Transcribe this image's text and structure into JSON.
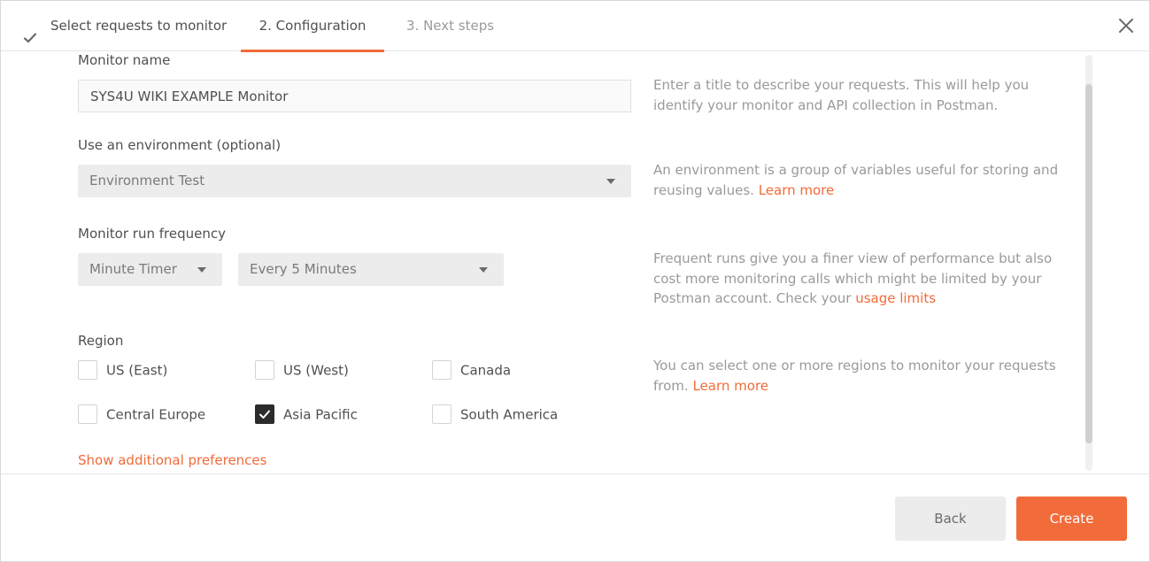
{
  "tabs": [
    {
      "label": "Select requests to monitor",
      "state": "completed"
    },
    {
      "label": "2. Configuration",
      "state": "active"
    },
    {
      "label": "3. Next steps",
      "state": "inactive"
    }
  ],
  "colors": {
    "accent": "#f26b3a",
    "muted": "#9a9a9a",
    "text": "#505050"
  },
  "form": {
    "monitor_name": {
      "label": "Monitor name",
      "value": "SYS4U WIKI EXAMPLE Monitor",
      "help": "Enter a title to describe your requests. This will help you identify your monitor and API collection in Postman."
    },
    "environment": {
      "label": "Use an environment (optional)",
      "selected": "Environment Test",
      "help": "An environment is a group of variables useful for storing and reusing values.",
      "help_link": "Learn more"
    },
    "frequency": {
      "label": "Monitor run frequency",
      "timer_selected": "Minute Timer",
      "interval_selected": "Every 5 Minutes",
      "help": "Frequent runs give you a finer view of performance but also cost more monitoring calls which might be limited by your Postman account. Check your",
      "help_link": "usage limits"
    },
    "region": {
      "label": "Region",
      "options": [
        {
          "label": "US (East)",
          "checked": false
        },
        {
          "label": "US (West)",
          "checked": false
        },
        {
          "label": "Canada",
          "checked": false
        },
        {
          "label": "Central Europe",
          "checked": false
        },
        {
          "label": "Asia Pacific",
          "checked": true
        },
        {
          "label": "South America",
          "checked": false
        }
      ],
      "help": "You can select one or more regions to monitor your requests from.",
      "help_link": "Learn more"
    },
    "additional_preferences_link": "Show additional preferences"
  },
  "footer": {
    "back_label": "Back",
    "create_label": "Create"
  },
  "icons": {
    "completed_tab": "check-icon",
    "close": "close-icon",
    "dropdown": "caret-down-icon",
    "checked_box": "check-icon"
  }
}
